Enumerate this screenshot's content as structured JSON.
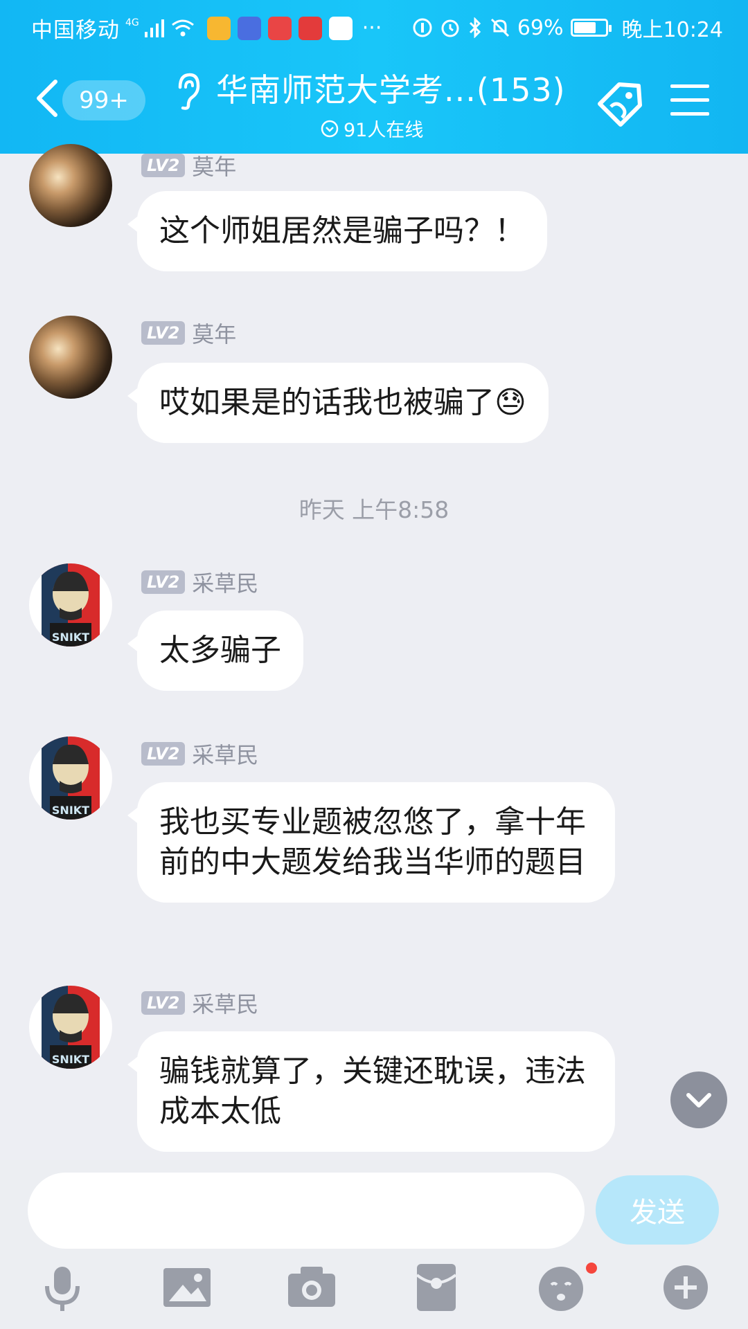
{
  "status_bar": {
    "carrier": "中国移动",
    "network": "4G",
    "battery": "69%",
    "time": "晚上10:24",
    "more": "···"
  },
  "header": {
    "unread_badge": "99+",
    "title": "华南师范大学考...(153)",
    "online": "91人在线"
  },
  "messages": [
    {
      "level": "LV2",
      "name": "莫年",
      "text": "这个师姐居然是骗子吗？！"
    },
    {
      "level": "LV2",
      "name": "莫年",
      "text": "哎如果是的话我也被骗了😓"
    },
    {
      "level": "LV2",
      "name": "采草民",
      "text": "太多骗子"
    },
    {
      "level": "LV2",
      "name": "采草民",
      "text": "我也买专业题被忽悠了，拿十年前的中大题发给我当华师的题目"
    },
    {
      "level": "LV2",
      "name": "采草民",
      "text": "骗钱就算了，关键还耽误，违法成本太低"
    }
  ],
  "timestamp": "昨天 上午8:58",
  "avatar_text": "SNIKT",
  "input": {
    "placeholder": "",
    "send_label": "发送"
  },
  "toolbar": [
    "mic-icon",
    "image-icon",
    "camera-icon",
    "red-packet-icon",
    "emoji-icon",
    "plus-icon"
  ],
  "colors": {
    "header": "#17bff7",
    "background": "#edeef3",
    "send_button": "#b6e7fa"
  }
}
